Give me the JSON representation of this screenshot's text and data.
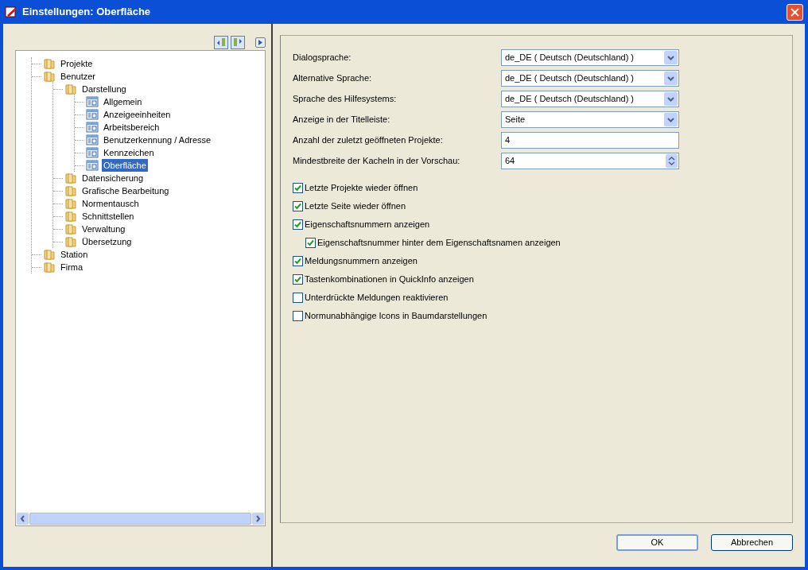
{
  "window": {
    "title": "Einstellungen: Oberfläche"
  },
  "tree": [
    {
      "label": "Projekte",
      "kind": "folder",
      "selected": false
    },
    {
      "label": "Benutzer",
      "kind": "folder",
      "selected": false,
      "children": [
        {
          "label": "Darstellung",
          "kind": "folder",
          "selected": false,
          "children": [
            {
              "label": "Allgemein",
              "kind": "page",
              "selected": false
            },
            {
              "label": "Anzeigeeinheiten",
              "kind": "page",
              "selected": false
            },
            {
              "label": "Arbeitsbereich",
              "kind": "page",
              "selected": false
            },
            {
              "label": "Benutzerkennung / Adresse",
              "kind": "page",
              "selected": false
            },
            {
              "label": "Kennzeichen",
              "kind": "page",
              "selected": false
            },
            {
              "label": "Oberfläche",
              "kind": "page",
              "selected": true
            }
          ]
        },
        {
          "label": "Datensicherung",
          "kind": "folder",
          "selected": false
        },
        {
          "label": "Grafische Bearbeitung",
          "kind": "folder",
          "selected": false
        },
        {
          "label": "Normentausch",
          "kind": "folder",
          "selected": false
        },
        {
          "label": "Schnittstellen",
          "kind": "folder",
          "selected": false
        },
        {
          "label": "Verwaltung",
          "kind": "folder",
          "selected": false
        },
        {
          "label": "Übersetzung",
          "kind": "folder",
          "selected": false
        }
      ]
    },
    {
      "label": "Station",
      "kind": "folder",
      "selected": false
    },
    {
      "label": "Firma",
      "kind": "folder",
      "selected": false
    }
  ],
  "fields": [
    {
      "label": "Dialogsprache:",
      "kind": "select",
      "value": "de_DE ( Deutsch (Deutschland) )"
    },
    {
      "label": "Alternative Sprache:",
      "kind": "select",
      "value": "de_DE ( Deutsch (Deutschland) )"
    },
    {
      "label": "Sprache des Hilfesystems:",
      "kind": "select",
      "value": "de_DE ( Deutsch (Deutschland) )"
    },
    {
      "label": "Anzeige in der Titelleiste:",
      "kind": "select",
      "value": "Seite"
    },
    {
      "label": "Anzahl der zuletzt geöffneten Projekte:",
      "kind": "text",
      "value": "4"
    },
    {
      "label": "Mindestbreite der Kacheln in der Vorschau:",
      "kind": "spinner",
      "value": "64"
    }
  ],
  "options": [
    {
      "label": "Letzte Projekte wieder öffnen",
      "checked": true
    },
    {
      "label": "Letzte Seite wieder öffnen",
      "checked": true
    },
    {
      "label": "Eigenschaftsnummern anzeigen",
      "checked": true,
      "children": [
        {
          "label": "Eigenschaftsnummer hinter dem Eigenschaftsnamen anzeigen",
          "checked": true
        }
      ]
    },
    {
      "label": "Meldungsnummern anzeigen",
      "checked": true
    },
    {
      "label": "Tastenkombinationen in QuickInfo anzeigen",
      "checked": true
    },
    {
      "label": "Unterdrückte Meldungen reaktivieren",
      "checked": false
    },
    {
      "label": "Normunabhängige Icons in Baumdarstellungen",
      "checked": false
    }
  ],
  "buttons": [
    "OK",
    "Abbrechen"
  ]
}
